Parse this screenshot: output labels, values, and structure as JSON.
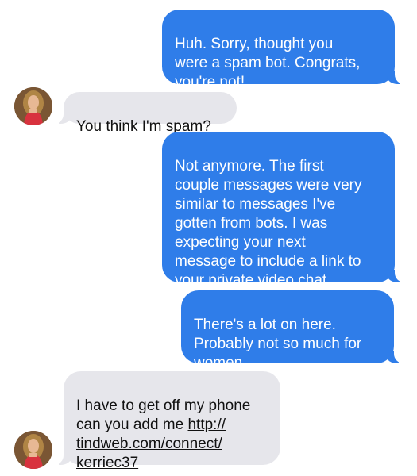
{
  "messages": [
    {
      "direction": "sent",
      "text": "Huh. Sorry, thought you\nwere a spam bot. Congrats,\nyou're not!"
    },
    {
      "direction": "received",
      "text": "You think I'm spam?"
    },
    {
      "direction": "sent",
      "text": "Not anymore. The first\ncouple messages were very\nsimilar to messages I've\ngotten from bots. I was\nexpecting your next\nmessage to include a link to\nyour private video chat."
    },
    {
      "direction": "sent",
      "text": "There's a lot on here.\nProbably not so much for\nwomen"
    },
    {
      "direction": "received",
      "text_before_link": "I have to get off my phone\ncan you add me ",
      "link": "http://\ntindweb.com/connect/\nkerriec37"
    }
  ],
  "colors": {
    "sent_bubble": "#2f7de9",
    "received_bubble": "#e6e6eb",
    "sent_text": "#ffffff",
    "received_text": "#111111"
  },
  "icons": {
    "avatar": "contact-photo"
  }
}
